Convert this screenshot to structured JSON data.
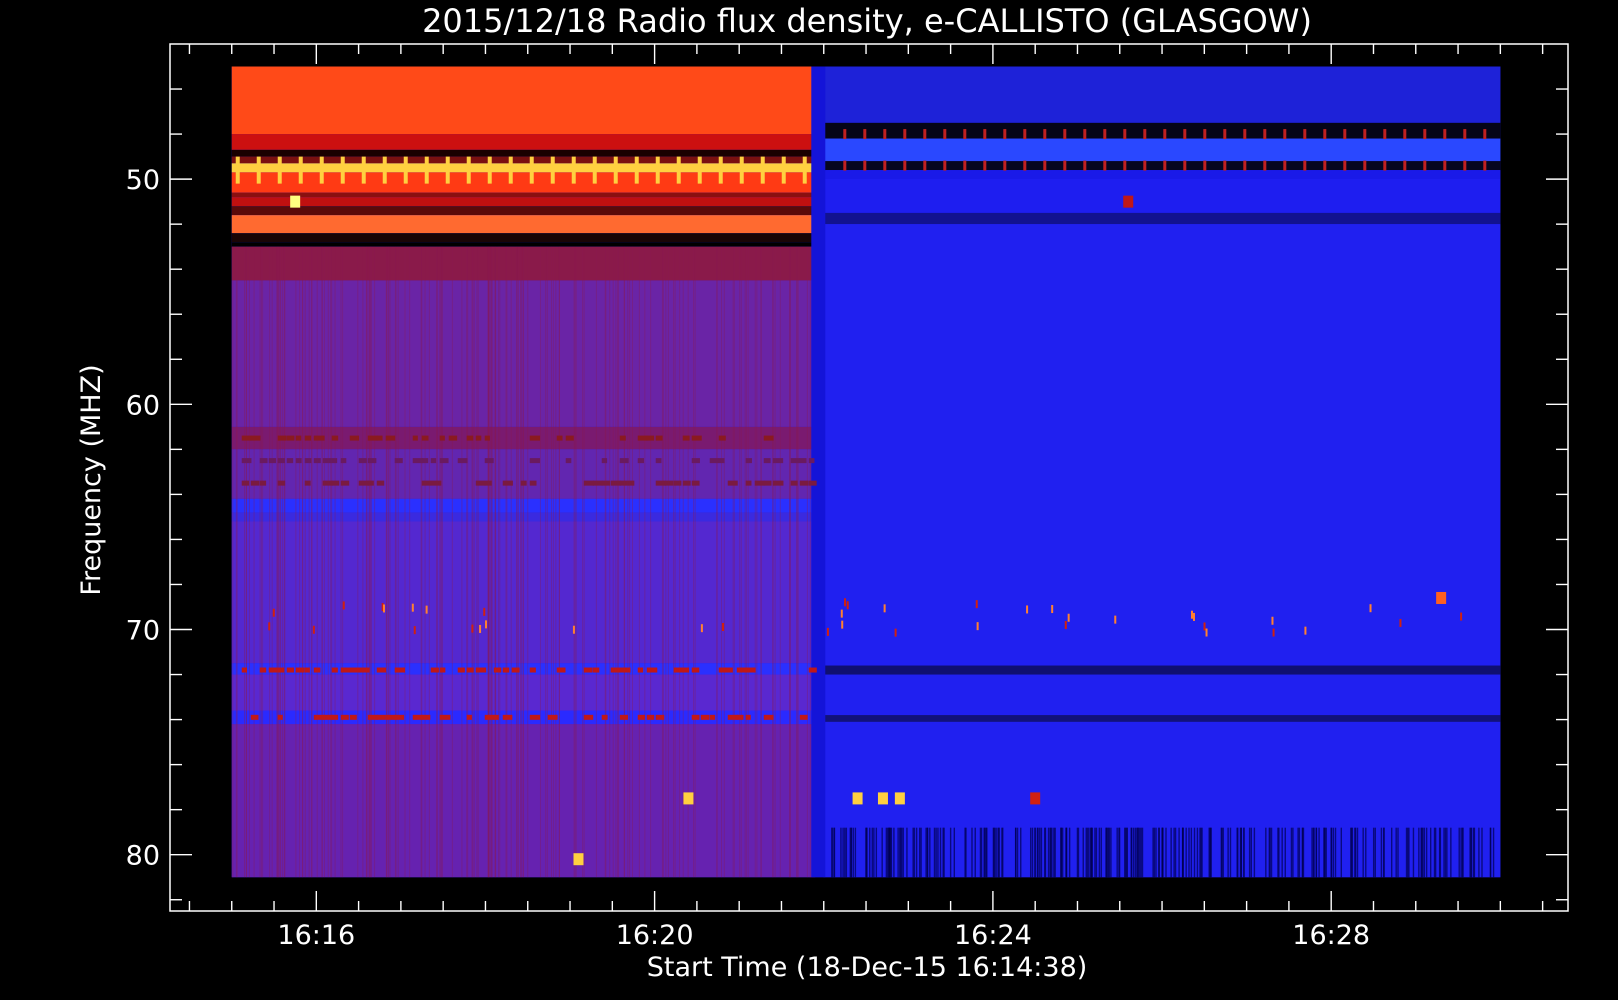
{
  "chart_data": {
    "type": "heatmap",
    "title": "2015/12/18  Radio flux density, e-CALLISTO (GLASGOW)",
    "xlabel": "Start Time (18-Dec-15 16:14:38)",
    "ylabel": "Frequency (MHZ)",
    "x_tick_labels": [
      "16:16",
      "16:20",
      "16:24",
      "16:28"
    ],
    "y_tick_labels": [
      "50",
      "60",
      "70",
      "80"
    ],
    "x_tick_minutes": [
      16,
      20,
      24,
      28
    ],
    "y_ticks": [
      50,
      60,
      70,
      80
    ],
    "x_start_minute": 14.633,
    "x_data_range_minutes": [
      15.0,
      30.0
    ],
    "x_axis_range_minutes": [
      14.27,
      30.8
    ],
    "y_data_range": [
      45.0,
      81.0
    ],
    "y_axis_range": [
      44.0,
      82.5
    ],
    "y_inverted": true,
    "regime_change_minute": 21.9,
    "colormap": [
      "#000000",
      "#1a1aff",
      "#3333ff",
      "#5a2ad0",
      "#6a26a8",
      "#8a1030",
      "#d01010",
      "#ff3010",
      "#ff6020",
      "#ffd040"
    ],
    "background_color": "#000000",
    "text_color": "#ffffff",
    "before_bands": [
      {
        "from": 45.0,
        "to": 48.0,
        "color": "#ff4a18"
      },
      {
        "from": 48.0,
        "to": 48.7,
        "color": "#cc1010"
      },
      {
        "from": 48.7,
        "to": 49.0,
        "color": "#1a0000"
      },
      {
        "from": 49.0,
        "to": 49.3,
        "color": "#7a1010"
      },
      {
        "from": 49.3,
        "to": 49.7,
        "color": "#ffd040"
      },
      {
        "from": 49.7,
        "to": 50.6,
        "color": "#ff3a14"
      },
      {
        "from": 50.6,
        "to": 50.8,
        "color": "#8a1010"
      },
      {
        "from": 50.8,
        "to": 51.2,
        "color": "#c01010"
      },
      {
        "from": 51.2,
        "to": 51.6,
        "color": "#5a0a0a"
      },
      {
        "from": 51.6,
        "to": 52.4,
        "color": "#ff6a30"
      },
      {
        "from": 52.4,
        "to": 52.8,
        "color": "#1a0505"
      },
      {
        "from": 52.8,
        "to": 53.0,
        "color": "#000000"
      },
      {
        "from": 53.0,
        "to": 54.5,
        "color": "#8a1a4a"
      },
      {
        "from": 54.5,
        "to": 61.0,
        "color": "#6a24a6"
      },
      {
        "from": 61.0,
        "to": 62.0,
        "color": "#7a1a70"
      },
      {
        "from": 62.0,
        "to": 64.2,
        "color": "#6226b0"
      },
      {
        "from": 64.2,
        "to": 64.8,
        "color": "#2a30ff"
      },
      {
        "from": 64.8,
        "to": 65.2,
        "color": "#3a2ae0"
      },
      {
        "from": 65.2,
        "to": 71.5,
        "color": "#5428d0"
      },
      {
        "from": 71.5,
        "to": 72.0,
        "color": "#2a30ff"
      },
      {
        "from": 72.0,
        "to": 73.6,
        "color": "#5a28d0"
      },
      {
        "from": 73.6,
        "to": 74.2,
        "color": "#2a2aff"
      },
      {
        "from": 74.2,
        "to": 81.0,
        "color": "#6622b0"
      }
    ],
    "after_bands": [
      {
        "from": 45.0,
        "to": 47.5,
        "color": "#1e22d8"
      },
      {
        "from": 47.5,
        "to": 48.2,
        "color": "#050518"
      },
      {
        "from": 48.2,
        "to": 49.2,
        "color": "#2a48ff"
      },
      {
        "from": 49.2,
        "to": 49.6,
        "color": "#060620"
      },
      {
        "from": 49.6,
        "to": 50.0,
        "color": "#1a1ae8"
      },
      {
        "from": 50.0,
        "to": 51.5,
        "color": "#1e1ef0"
      },
      {
        "from": 51.5,
        "to": 52.0,
        "color": "#121290"
      },
      {
        "from": 52.0,
        "to": 81.0,
        "color": "#2020f0"
      },
      {
        "from": 71.6,
        "to": 72.0,
        "color": "#101070"
      },
      {
        "from": 73.8,
        "to": 74.1,
        "color": "#12127a"
      }
    ],
    "before_lines": [
      {
        "freq": 61.5,
        "color": "#8a1a20"
      },
      {
        "freq": 62.5,
        "color": "#6a1a60"
      },
      {
        "freq": 63.5,
        "color": "#7a1a40"
      },
      {
        "freq": 71.8,
        "color": "#c01818"
      },
      {
        "freq": 73.9,
        "color": "#c01818"
      }
    ],
    "after_lines": [
      {
        "freq": 48.0,
        "color": "#c02020"
      },
      {
        "freq": 49.4,
        "color": "#c02020"
      }
    ],
    "spots": [
      {
        "minute": 15.75,
        "freq": 51.0,
        "color": "#ffff80"
      },
      {
        "minute": 25.6,
        "freq": 51.0,
        "color": "#c01818"
      },
      {
        "minute": 19.1,
        "freq": 80.2,
        "color": "#ffd040"
      },
      {
        "minute": 22.4,
        "freq": 77.5,
        "color": "#ffd040"
      },
      {
        "minute": 22.7,
        "freq": 77.5,
        "color": "#ffd040"
      },
      {
        "minute": 22.9,
        "freq": 77.5,
        "color": "#ffd040"
      },
      {
        "minute": 24.5,
        "freq": 77.5,
        "color": "#d02010"
      },
      {
        "minute": 29.3,
        "freq": 68.6,
        "color": "#ff6020"
      },
      {
        "minute": 20.4,
        "freq": 77.5,
        "color": "#ffd040"
      }
    ]
  }
}
